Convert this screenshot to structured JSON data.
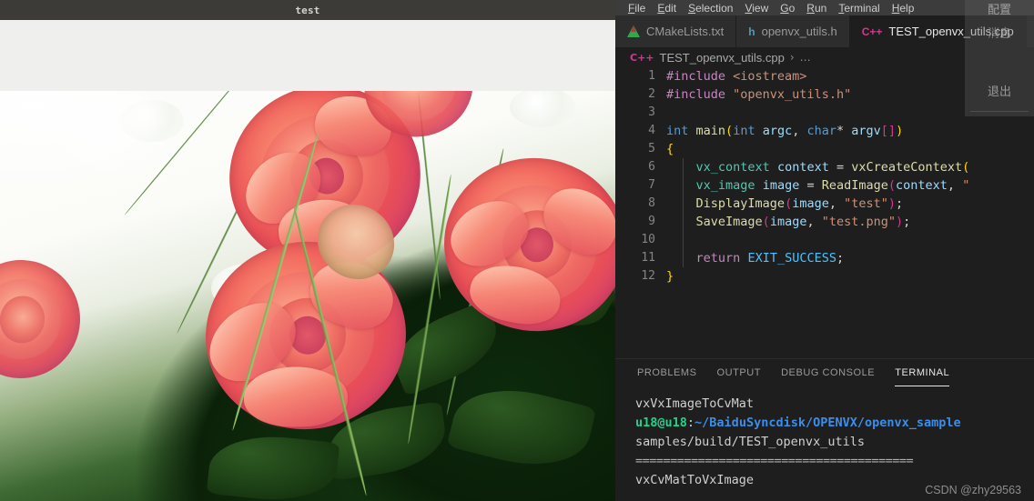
{
  "image_window": {
    "title": "test",
    "photo_alt": "coral-pink roses bouquet photograph"
  },
  "vscode": {
    "menubar": [
      {
        "label": "File",
        "mnemonic": "F"
      },
      {
        "label": "Edit",
        "mnemonic": "E"
      },
      {
        "label": "Selection",
        "mnemonic": "S"
      },
      {
        "label": "View",
        "mnemonic": "V"
      },
      {
        "label": "Go",
        "mnemonic": "G"
      },
      {
        "label": "Run",
        "mnemonic": "R"
      },
      {
        "label": "Terminal",
        "mnemonic": "T"
      },
      {
        "label": "Help",
        "mnemonic": "H"
      }
    ],
    "tabs": [
      {
        "label": "CMakeLists.txt",
        "icon": "cmake-icon",
        "icon_text": "",
        "active": false
      },
      {
        "label": "openvx_utils.h",
        "icon": "h-file-icon",
        "icon_text": "h",
        "active": false
      },
      {
        "label": "TEST_openvx_utils.cpp",
        "icon": "cpp-file-icon",
        "icon_text": "C++",
        "active": true
      }
    ],
    "breadcrumb": {
      "icon_text": "C++",
      "file": "TEST_openvx_utils.cpp",
      "separator": "›",
      "ellipsis": "…"
    },
    "editor": {
      "lines": [
        {
          "no": "1",
          "tokens": [
            {
              "t": "#include ",
              "c": "t-pre"
            },
            {
              "t": "<iostream>",
              "c": "t-incl"
            }
          ]
        },
        {
          "no": "2",
          "tokens": [
            {
              "t": "#include ",
              "c": "t-pre"
            },
            {
              "t": "\"openvx_utils.h\"",
              "c": "t-str"
            }
          ]
        },
        {
          "no": "3",
          "tokens": []
        },
        {
          "no": "4",
          "tokens": [
            {
              "t": "int",
              "c": "t-key"
            },
            {
              "t": " ",
              "c": "t-plain"
            },
            {
              "t": "main",
              "c": "t-fn"
            },
            {
              "t": "(",
              "c": "t-brace"
            },
            {
              "t": "int",
              "c": "t-key"
            },
            {
              "t": " ",
              "c": "t-plain"
            },
            {
              "t": "argc",
              "c": "t-var"
            },
            {
              "t": ", ",
              "c": "t-punct"
            },
            {
              "t": "char",
              "c": "t-key"
            },
            {
              "t": "* ",
              "c": "t-punct"
            },
            {
              "t": "argv",
              "c": "t-var"
            },
            {
              "t": "[]",
              "c": "t-paren"
            },
            {
              "t": ")",
              "c": "t-brace"
            }
          ]
        },
        {
          "no": "5",
          "tokens": [
            {
              "t": "{",
              "c": "t-brace"
            }
          ]
        },
        {
          "no": "6",
          "tokens": [
            {
              "t": "    ",
              "c": "t-plain"
            },
            {
              "t": "vx_context",
              "c": "t-type"
            },
            {
              "t": " ",
              "c": "t-plain"
            },
            {
              "t": "context",
              "c": "t-var"
            },
            {
              "t": " = ",
              "c": "t-punct"
            },
            {
              "t": "vxCreateContext",
              "c": "t-fn"
            },
            {
              "t": "(",
              "c": "t-brace"
            }
          ]
        },
        {
          "no": "7",
          "tokens": [
            {
              "t": "    ",
              "c": "t-plain"
            },
            {
              "t": "vx_image",
              "c": "t-type"
            },
            {
              "t": " ",
              "c": "t-plain"
            },
            {
              "t": "image",
              "c": "t-var"
            },
            {
              "t": " = ",
              "c": "t-punct"
            },
            {
              "t": "ReadImage",
              "c": "t-fn"
            },
            {
              "t": "(",
              "c": "t-paren"
            },
            {
              "t": "context",
              "c": "t-var"
            },
            {
              "t": ", ",
              "c": "t-punct"
            },
            {
              "t": "\"",
              "c": "t-str"
            }
          ]
        },
        {
          "no": "8",
          "tokens": [
            {
              "t": "    ",
              "c": "t-plain"
            },
            {
              "t": "DisplayImage",
              "c": "t-fn"
            },
            {
              "t": "(",
              "c": "t-paren"
            },
            {
              "t": "image",
              "c": "t-var"
            },
            {
              "t": ", ",
              "c": "t-punct"
            },
            {
              "t": "\"test\"",
              "c": "t-str"
            },
            {
              "t": ")",
              "c": "t-paren"
            },
            {
              "t": ";",
              "c": "t-punct"
            }
          ]
        },
        {
          "no": "9",
          "tokens": [
            {
              "t": "    ",
              "c": "t-plain"
            },
            {
              "t": "SaveImage",
              "c": "t-fn"
            },
            {
              "t": "(",
              "c": "t-paren"
            },
            {
              "t": "image",
              "c": "t-var"
            },
            {
              "t": ", ",
              "c": "t-punct"
            },
            {
              "t": "\"test.png\"",
              "c": "t-str"
            },
            {
              "t": ")",
              "c": "t-paren"
            },
            {
              "t": ";",
              "c": "t-punct"
            }
          ]
        },
        {
          "no": "10",
          "tokens": []
        },
        {
          "no": "11",
          "tokens": [
            {
              "t": "    ",
              "c": "t-plain"
            },
            {
              "t": "return",
              "c": "t-ctrl"
            },
            {
              "t": " ",
              "c": "t-plain"
            },
            {
              "t": "EXIT_SUCCESS",
              "c": "t-const"
            },
            {
              "t": ";",
              "c": "t-punct"
            }
          ]
        },
        {
          "no": "12",
          "tokens": [
            {
              "t": "}",
              "c": "t-brace"
            }
          ]
        }
      ]
    },
    "panel": {
      "tabs": [
        {
          "label": "PROBLEMS",
          "active": false
        },
        {
          "label": "OUTPUT",
          "active": false
        },
        {
          "label": "DEBUG CONSOLE",
          "active": false
        },
        {
          "label": "TERMINAL",
          "active": true
        }
      ],
      "terminal_lines": [
        {
          "segments": [
            {
              "t": "vxVxImageToCvMat",
              "c": "tc-white"
            }
          ]
        },
        {
          "segments": [
            {
              "t": "u18@u18",
              "c": "tc-green"
            },
            {
              "t": ":",
              "c": "tc-white"
            },
            {
              "t": "~/BaiduSyncdisk/OPENVX/openvx_sample",
              "c": "tc-blue"
            }
          ]
        },
        {
          "segments": [
            {
              "t": "samples/build/TEST_openvx_utils",
              "c": "tc-white"
            }
          ]
        },
        {
          "segments": [
            {
              "t": "========================================",
              "c": "tc-sep"
            }
          ]
        },
        {
          "segments": [
            {
              "t": "vxCvMatToVxImage",
              "c": "tc-white"
            }
          ]
        }
      ]
    },
    "watermark": "CSDN @zhy29563"
  },
  "overlay_menu": {
    "config_label": "配置",
    "middle_label": "消息",
    "exit_label": "退出"
  },
  "colors": {
    "vscode_bg": "#1e1e1e",
    "tab_inactive_bg": "#2d2d2d",
    "menubar_bg": "#3c3c3c",
    "accent_cpp": "#d1398f",
    "accent_h": "#519aba",
    "terminal_green": "#23d18b",
    "terminal_blue": "#3b8eea",
    "window_titlebar": "#3c3b37"
  }
}
